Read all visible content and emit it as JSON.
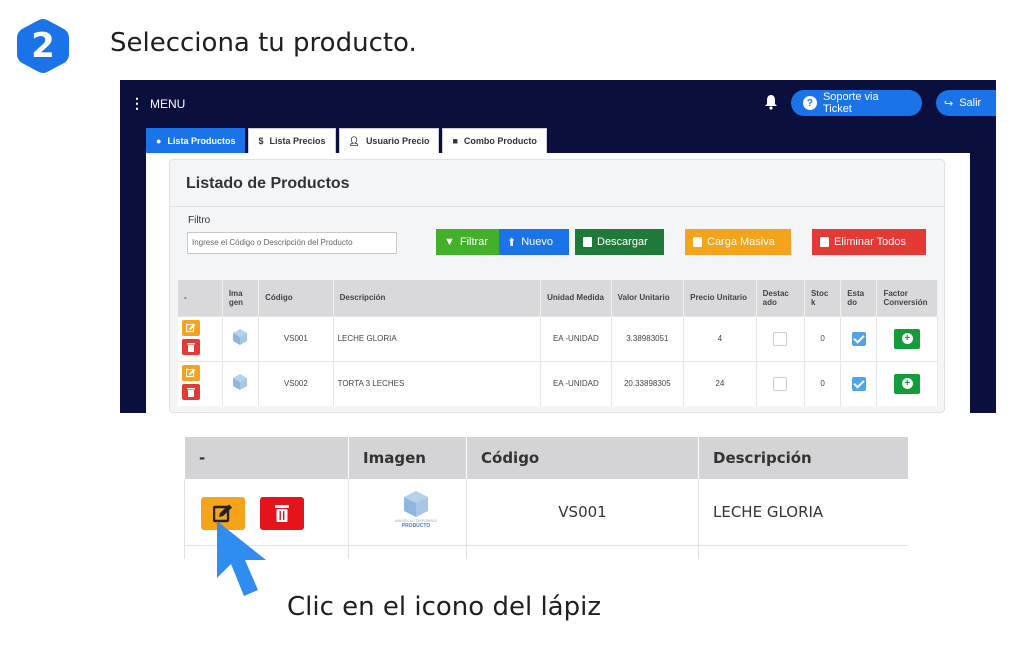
{
  "step": {
    "number": "2",
    "title": "Selecciona tu producto."
  },
  "app": {
    "menu_label": "MENU",
    "soporte_label": "Soporte via Ticket",
    "salir_label": "Salir",
    "tabs": [
      {
        "label": "Lista Productos",
        "icon": "circle-icon",
        "active": true
      },
      {
        "label": "Lista Precios",
        "icon": "dollar-icon",
        "active": false
      },
      {
        "label": "Usuario Precio",
        "icon": "user-icon",
        "active": false
      },
      {
        "label": "Combo Producto",
        "icon": "bag-icon",
        "active": false
      }
    ],
    "card_title": "Listado de Productos",
    "filtro_label": "Filtro",
    "filtro_placeholder": "Ingrese el Código o Descripción del Producto",
    "buttons": {
      "filtrar": "Filtrar",
      "nuevo": "Nuevo",
      "descargar": "Descargar",
      "carga_masiva": "Carga Masiva",
      "eliminar_todos": "Eliminar Todos"
    },
    "table": {
      "headers": [
        "-",
        "Ima gen",
        "Código",
        "Descripción",
        "Unidad Medida",
        "Valor Unitario",
        "Precio Unitario",
        "Destac ado",
        "Stoc k",
        "Esta do",
        "Factor Conversión"
      ],
      "rows": [
        {
          "codigo": "VS001",
          "descripcion": "LECHE GLORIA",
          "unidad": "EA -UNIDAD",
          "valor": "3.38983051",
          "precio": "4",
          "destacado": false,
          "stock": "0",
          "estado": true
        },
        {
          "codigo": "VS002",
          "descripcion": "TORTA 3 LECHES",
          "unidad": "EA -UNIDAD",
          "valor": "20.33898305",
          "precio": "24",
          "destacado": false,
          "stock": "0",
          "estado": true
        }
      ]
    }
  },
  "zoom": {
    "headers": [
      "-",
      "Imagen",
      "Código",
      "Descripción"
    ],
    "codigo": "VS001",
    "descripcion": "LECHE GLORIA",
    "image_caption_small": "IMAGEN NO DISPONIBLE",
    "image_caption_brand": "PRODUCTO"
  },
  "caption": "Clic en el icono del lápiz",
  "colors": {
    "step_badge": "#1a73e8",
    "navbar": "#0b0f3d",
    "primary": "#1a73e8",
    "edit": "#f5a31a",
    "delete": "#e53935",
    "success": "#43b02a",
    "cursor": "#2f8cf0"
  }
}
